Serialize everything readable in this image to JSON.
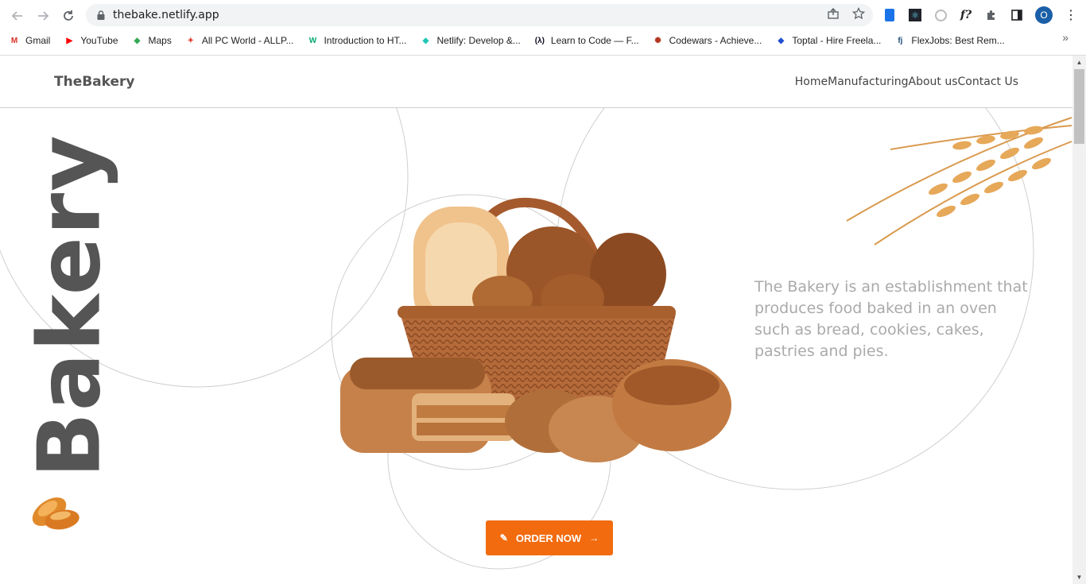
{
  "browser": {
    "url": "thebake.netlify.app",
    "avatar_letter": "O",
    "bookmarks": [
      {
        "label": "Gmail",
        "icon": "gmail-icon",
        "glyph": "M",
        "color": "#d93025"
      },
      {
        "label": "YouTube",
        "icon": "youtube-icon",
        "glyph": "▶",
        "color": "#ff0000"
      },
      {
        "label": "Maps",
        "icon": "maps-icon",
        "glyph": "◆",
        "color": "#34a853"
      },
      {
        "label": "All PC World - ALLP...",
        "icon": "allpcworld-icon",
        "glyph": "✦",
        "color": "#ea4335"
      },
      {
        "label": "Introduction to HT...",
        "icon": "w3schools-icon",
        "glyph": "W",
        "color": "#04aa6d"
      },
      {
        "label": "Netlify: Develop &...",
        "icon": "netlify-icon",
        "glyph": "◆",
        "color": "#20c6b7"
      },
      {
        "label": "Learn to Code — F...",
        "icon": "freecodecamp-icon",
        "glyph": "(λ)",
        "color": "#0a0a23"
      },
      {
        "label": "Codewars - Achieve...",
        "icon": "codewars-icon",
        "glyph": "✺",
        "color": "#b1361e"
      },
      {
        "label": "Toptal - Hire Freela...",
        "icon": "toptal-icon",
        "glyph": "◆",
        "color": "#204ecf"
      },
      {
        "label": "FlexJobs: Best Rem...",
        "icon": "flexjobs-icon",
        "glyph": "fj",
        "color": "#1f4e79"
      }
    ]
  },
  "site": {
    "brand": "TheBakery",
    "nav": [
      "Home",
      "Manufacturing",
      "About us",
      "Contact Us"
    ],
    "big_word": "Bakery",
    "description": "The Bakery is an establishment that produces food baked in an oven such as bread, cookies, cakes, pastries and pies.",
    "cta": "ORDER NOW",
    "accent_color": "#f26b0f"
  }
}
